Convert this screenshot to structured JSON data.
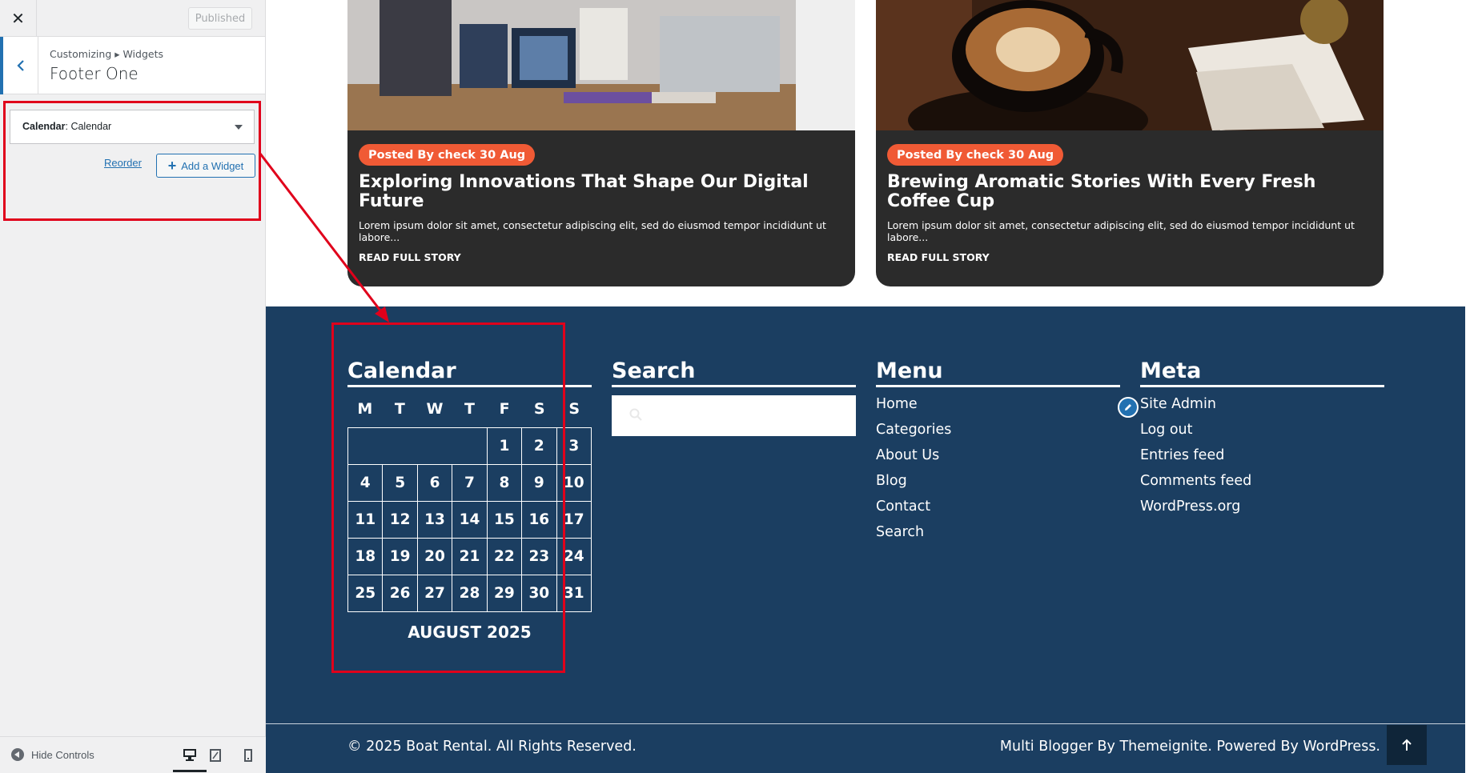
{
  "sidebar": {
    "close_icon": "close-icon",
    "published_label": "Published",
    "breadcrumb": "Customizing ▸ Widgets",
    "section_title": "Footer One",
    "widget": {
      "type_label": "Calendar",
      "sep": ": ",
      "name": "Calendar"
    },
    "reorder_label": "Reorder",
    "add_widget_label": "Add a Widget",
    "hide_controls_label": "Hide Controls"
  },
  "cards": [
    {
      "badge": "Posted By check 30 Aug",
      "title": "Exploring Innovations That Shape Our Digital Future",
      "excerpt": "Lorem ipsum dolor sit amet, consectetur adipiscing elit, sed do eiusmod tempor incididunt ut labore...",
      "link": "READ FULL STORY"
    },
    {
      "badge": "Posted By check 30 Aug",
      "title": "Brewing Aromatic Stories With Every Fresh Coffee Cup",
      "excerpt": "Lorem ipsum dolor sit amet, consectetur adipiscing elit, sed do eiusmod tempor incididunt ut labore...",
      "link": "READ FULL STORY"
    }
  ],
  "footer": {
    "calendar": {
      "title": "Calendar",
      "weekdays": [
        "M",
        "T",
        "W",
        "T",
        "F",
        "S",
        "S"
      ],
      "rows": [
        [
          "",
          "",
          "",
          "",
          "1",
          "2",
          "3"
        ],
        [
          "4",
          "5",
          "6",
          "7",
          "8",
          "9",
          "10"
        ],
        [
          "11",
          "12",
          "13",
          "14",
          "15",
          "16",
          "17"
        ],
        [
          "18",
          "19",
          "20",
          "21",
          "22",
          "23",
          "24"
        ],
        [
          "25",
          "26",
          "27",
          "28",
          "29",
          "30",
          "31"
        ]
      ],
      "caption": "AUGUST 2025"
    },
    "search": {
      "title": "Search",
      "placeholder": ""
    },
    "menu": {
      "title": "Menu",
      "items": [
        "Home",
        "Categories",
        "About Us",
        "Blog",
        "Contact",
        "Search"
      ]
    },
    "meta": {
      "title": "Meta",
      "items": [
        "Site Admin",
        "Log out",
        "Entries feed",
        "Comments feed",
        "WordPress.org"
      ]
    },
    "copyright": "© 2025 Boat Rental. All Rights Reserved.",
    "credits": "Multi Blogger By Themeignite. Powered By WordPress."
  },
  "colors": {
    "accent": "#2271b1",
    "badge": "#f05a35",
    "footer_bg": "#1b3e61",
    "highlight": "#e0001b"
  }
}
